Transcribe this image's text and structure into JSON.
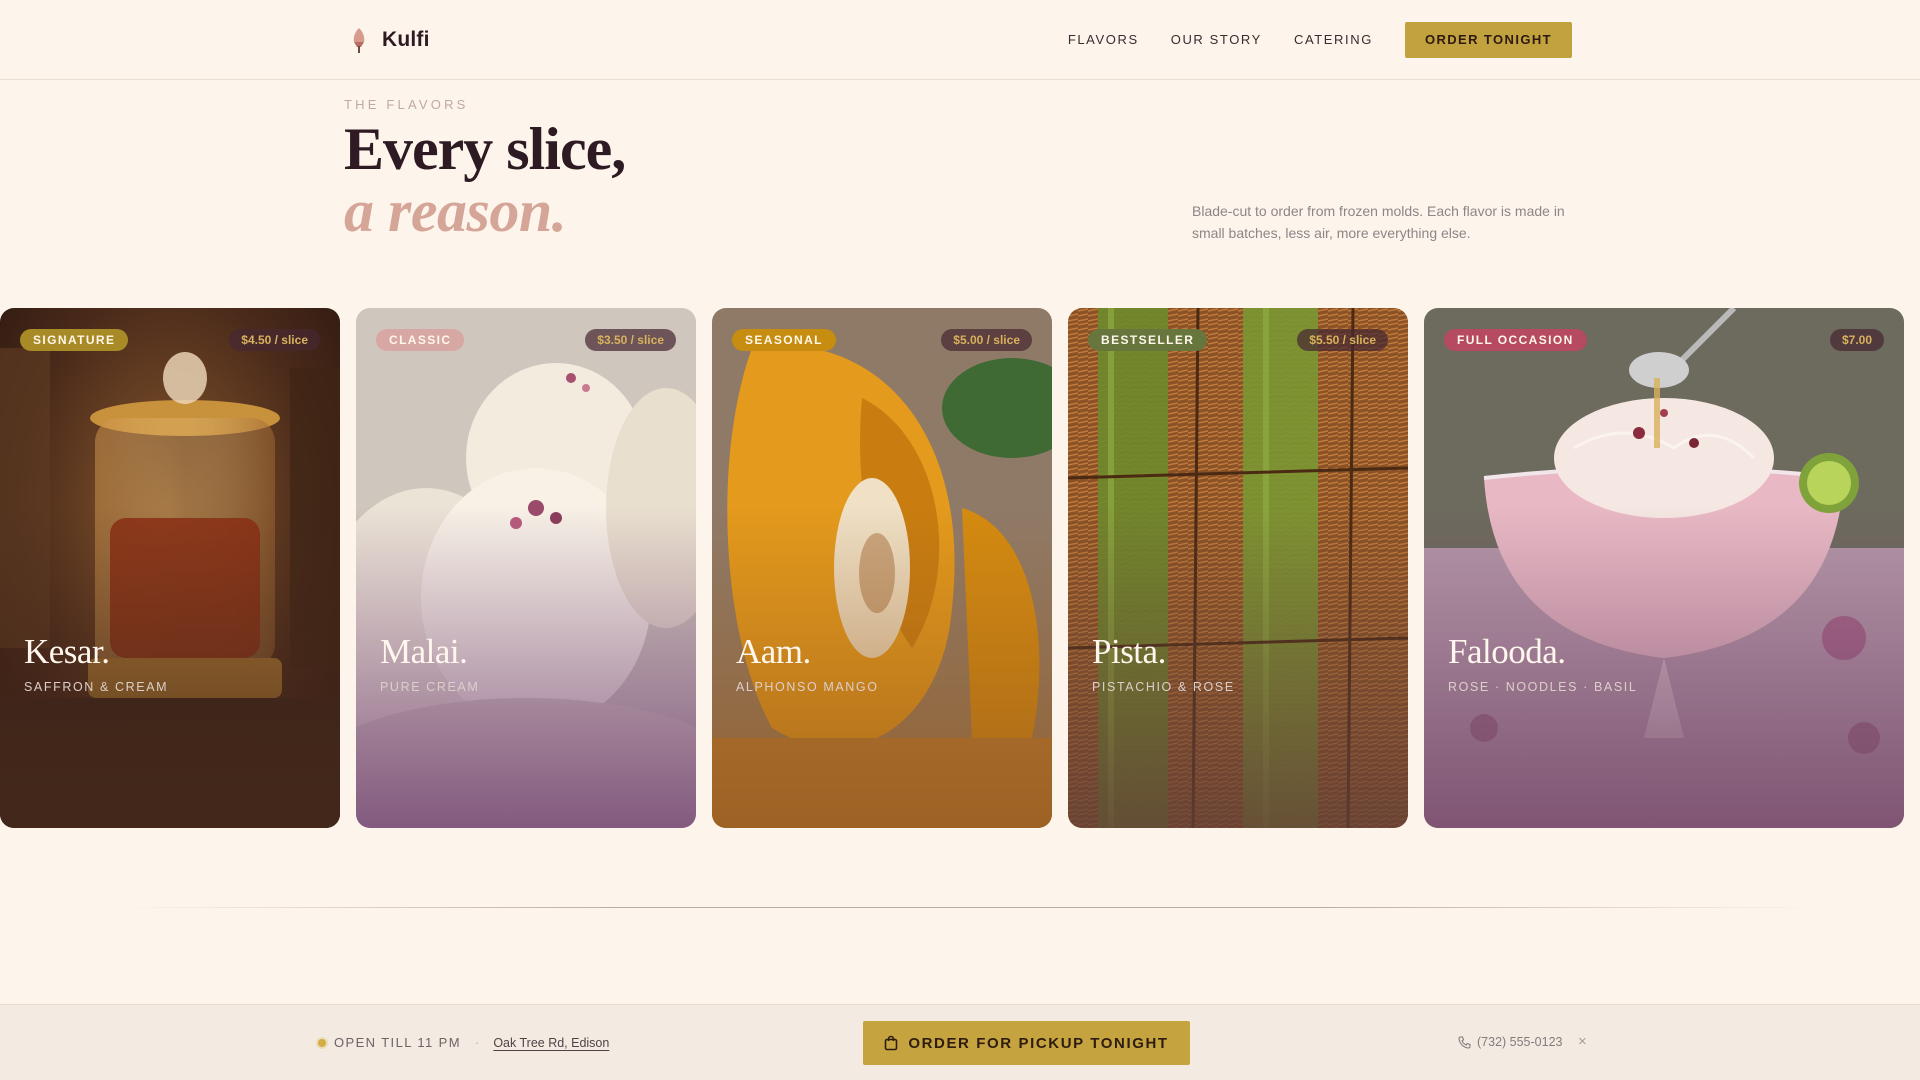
{
  "header": {
    "brand": "Kulfi",
    "nav": [
      "FLAVORS",
      "OUR STORY",
      "CATERING"
    ],
    "cta": "ORDER TONIGHT"
  },
  "hero": {
    "eyebrow": "THE FLAVORS",
    "line1": "Every slice,",
    "line2": "a reason.",
    "intro": "Blade-cut to order from frozen molds. Each flavor is made in small batches, less air, more everything else."
  },
  "cards": [
    {
      "tag": "SIGNATURE",
      "price": "$4.50 / slice",
      "title": "Kesar.",
      "subtitle": "SAFFRON & CREAM",
      "image_icon": "saffron-jar-image",
      "tag_color": "#a88a26"
    },
    {
      "tag": "CLASSIC",
      "price": "$3.50 / slice",
      "title": "Malai.",
      "subtitle": "PURE CREAM",
      "image_icon": "cream-kulfi-image",
      "tag_color": "#d7a7a4"
    },
    {
      "tag": "SEASONAL",
      "price": "$5.00 / slice",
      "title": "Aam.",
      "subtitle": "ALPHONSO MANGO",
      "image_icon": "mango-image",
      "tag_color": "#c68d10"
    },
    {
      "tag": "BESTSELLER",
      "price": "$5.50 / slice",
      "title": "Pista.",
      "subtitle": "PISTACHIO & ROSE",
      "image_icon": "pistachio-pastry-image",
      "tag_color": "#67763c"
    },
    {
      "tag": "FULL OCCASION",
      "price": "$7.00",
      "title": "Falooda.",
      "subtitle": "ROSE · NOODLES · BASIL",
      "image_icon": "falooda-bowl-image",
      "tag_color": "#b54a60"
    }
  ],
  "bottom_bar": {
    "status": "OPEN TILL 11 PM",
    "separator": "·",
    "address": "Oak Tree Rd, Edison",
    "pickup": "ORDER FOR PICKUP TONIGHT",
    "phone": "(732) 555-0123",
    "close": "×"
  },
  "colors": {
    "background": "#fdf5ec",
    "gold": "#c5a43f",
    "ink": "#2d1a22",
    "rose": "#d5a597"
  }
}
